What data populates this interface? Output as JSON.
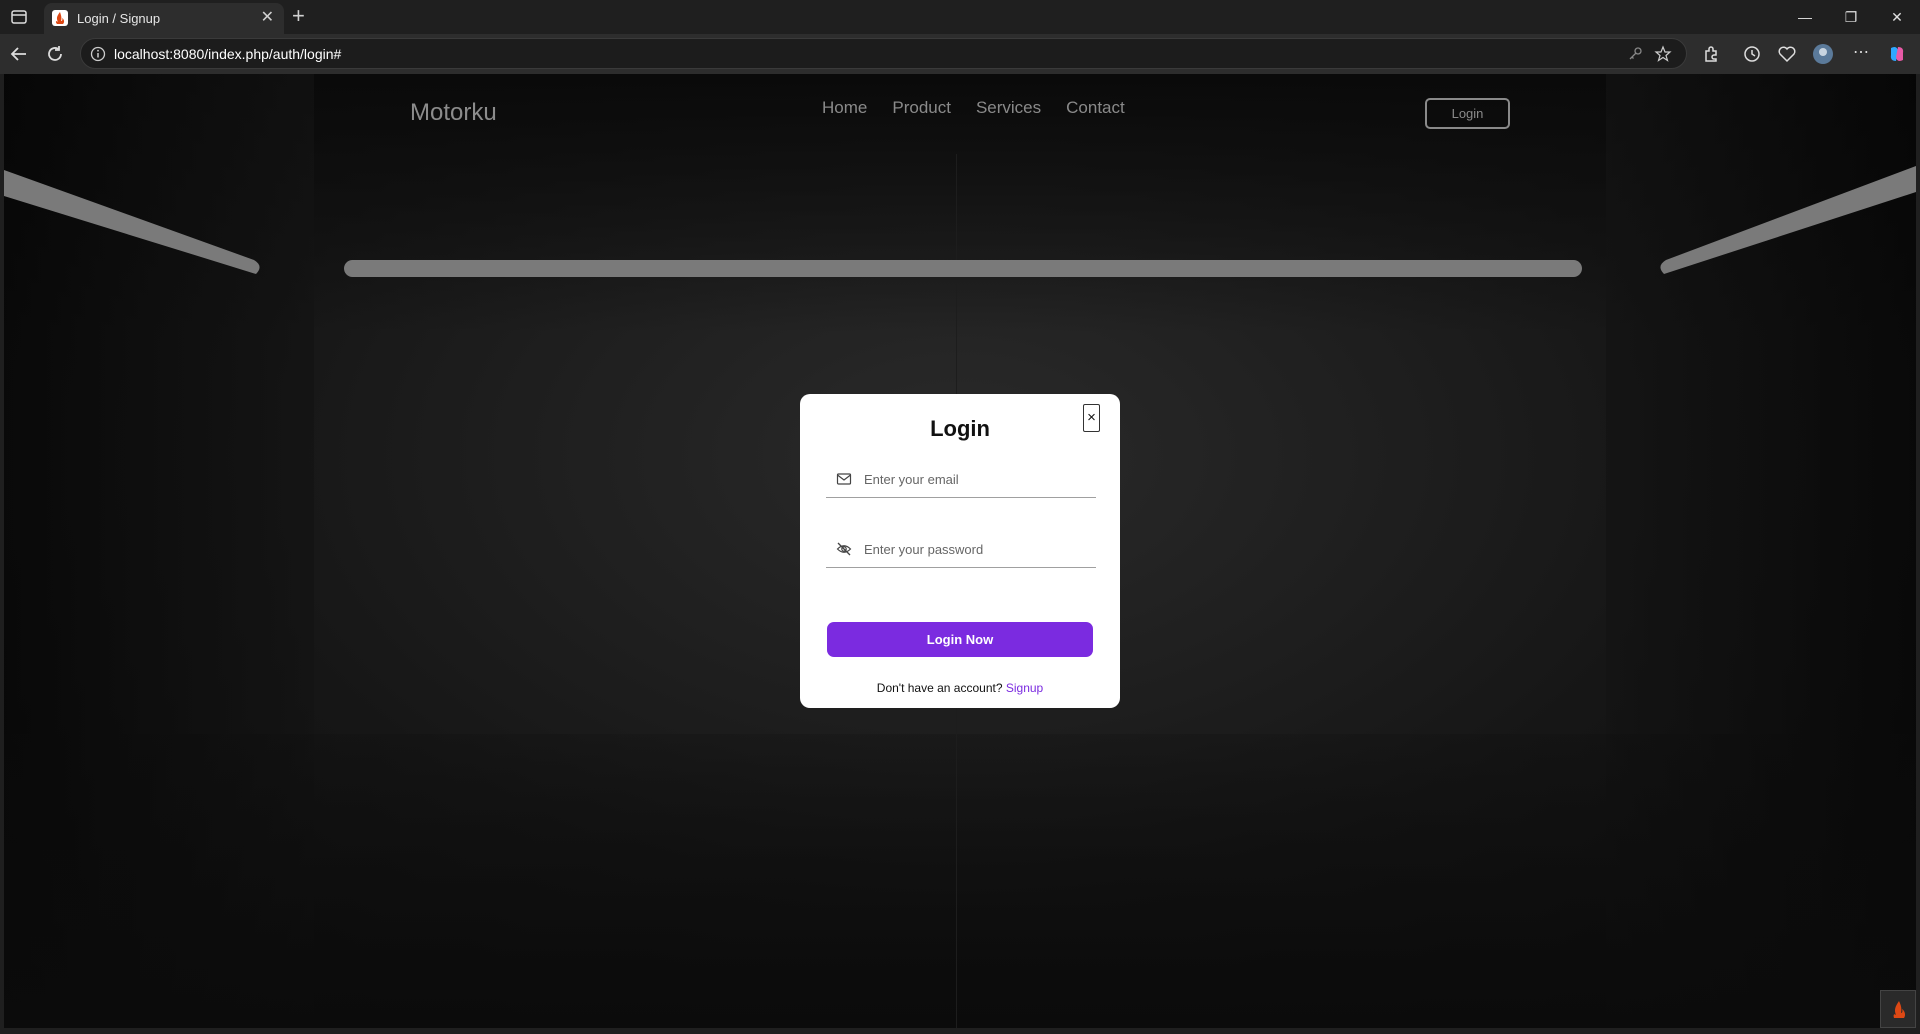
{
  "browser": {
    "tab_title": "Login / Signup",
    "address": "localhost:8080/index.php/auth/login#"
  },
  "nav": {
    "brand": "Motorku",
    "links": [
      "Home",
      "Product",
      "Services",
      "Contact"
    ],
    "login_button": "Login"
  },
  "modal": {
    "title": "Login",
    "close_glyph": "×",
    "email_placeholder": "Enter your email",
    "password_placeholder": "Enter your password",
    "submit_label": "Login Now",
    "signup_prompt": "Don't have an account?",
    "signup_link": "Signup"
  },
  "colors": {
    "accent": "#7b2be0"
  }
}
